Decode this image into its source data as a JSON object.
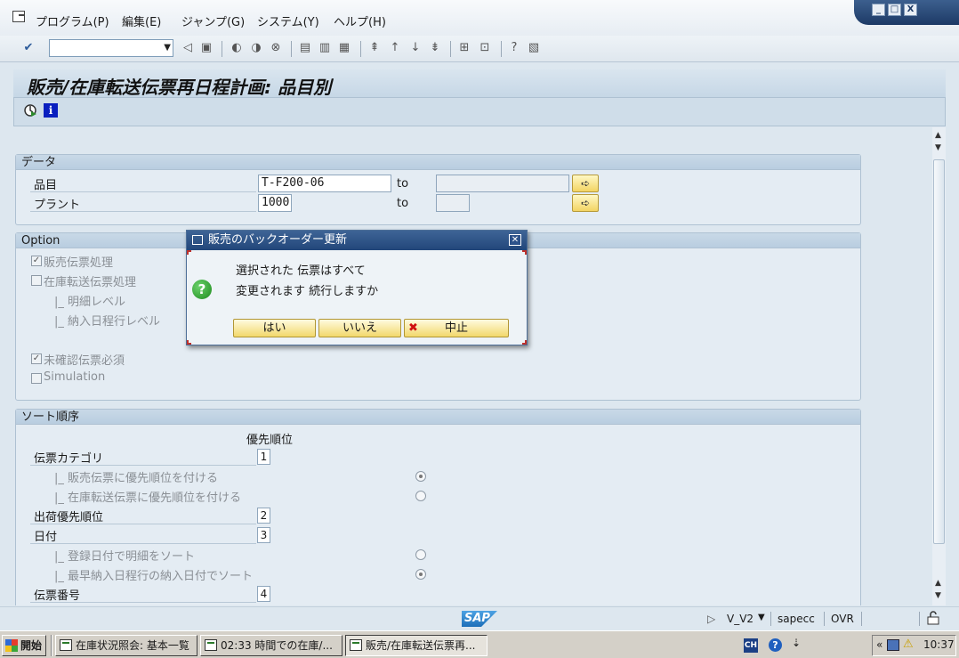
{
  "menu": {
    "items": [
      "プログラム(P)",
      "編集(E)",
      "ジャンプ(G)",
      "システム(Y)",
      "ヘルプ(H)"
    ],
    "system_buttons": [
      "_",
      "□",
      "X"
    ]
  },
  "toolbar": {
    "command_value": "",
    "icons": [
      "enter-icon",
      "back-icon",
      "save-icon",
      "back-arrow-icon",
      "exit-icon",
      "cancel-icon",
      "print-icon",
      "find-icon",
      "find-next-icon",
      "first-page-icon",
      "prev-page-icon",
      "next-page-icon",
      "last-page-icon",
      "new-session-icon",
      "shortcut-icon",
      "help-icon",
      "layout-icon"
    ]
  },
  "title": "販売/在庫転送伝票再日程計画: 品目別",
  "app_toolbar": {
    "icons": [
      "execute-icon",
      "info-icon"
    ]
  },
  "data_group": {
    "title": "データ",
    "rows": [
      {
        "label": "品目",
        "from": "T-F200-06",
        "to_label": "to",
        "to": ""
      },
      {
        "label": "プラント",
        "from": "1000",
        "to_label": "to",
        "to": ""
      }
    ]
  },
  "option_group": {
    "title": "Option",
    "items": [
      {
        "label": "販売伝票処理",
        "checked": true
      },
      {
        "label": "在庫転送伝票処理",
        "checked": false
      },
      {
        "label": "|_ 明細レベル"
      },
      {
        "label": "|_ 納入日程行レベル"
      },
      {
        "label": "未確認伝票必須",
        "checked": true
      },
      {
        "label": "Simulation",
        "checked": false
      }
    ]
  },
  "sort_group": {
    "title": "ソート順序",
    "priority_header": "優先順位",
    "rows": [
      {
        "label": "伝票カテゴリ",
        "priority": "1"
      },
      {
        "label": "|_ 販売伝票に優先順位を付ける",
        "radio": true
      },
      {
        "label": "|_ 在庫転送伝票に優先順位を付ける",
        "radio": false
      },
      {
        "label": "出荷優先順位",
        "priority": "2"
      },
      {
        "label": "日付",
        "priority": "3"
      },
      {
        "label": "|_ 登録日付で明細をソート",
        "radio": false
      },
      {
        "label": "|_ 最早納入日程行の納入日付でソート",
        "radio": true
      },
      {
        "label": "伝票番号",
        "priority": "4"
      }
    ]
  },
  "dialog": {
    "title": "販売のバックオーダー更新",
    "line1": "選択された 伝票はすべて",
    "line2": "変更されます  続行しますか",
    "buttons": {
      "yes": "はい",
      "no": "いいえ",
      "cancel": "中止"
    }
  },
  "status": {
    "logo": "SAP",
    "transaction": "V_V2",
    "server": "sapecc",
    "mode": "OVR"
  },
  "taskbar": {
    "start": "開始",
    "tasks": [
      "在庫状況照会: 基本一覧",
      "02:33 時間での在庫/...",
      "販売/在庫転送伝票再..."
    ],
    "lang": "CH",
    "time": "10:37"
  }
}
